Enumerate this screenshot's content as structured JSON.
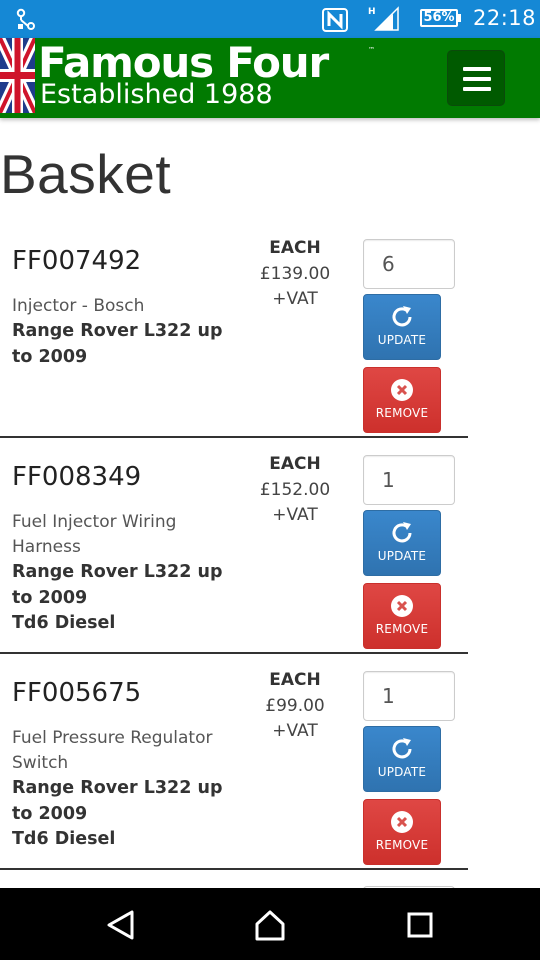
{
  "status_bar": {
    "battery_percent": "56%",
    "time": "22:18",
    "network_indicator": "H",
    "icons": [
      "ongoing-notification-icon",
      "nfc-icon",
      "signal-icon",
      "battery-icon"
    ],
    "background_color": "#1588d5"
  },
  "header": {
    "brand_name": "Famous Four",
    "trademark": "™",
    "tagline": "Established 1988",
    "background_color": "#017a01",
    "icons": [
      "union-jack-flag-icon",
      "hamburger-menu-icon"
    ]
  },
  "page": {
    "title": "Basket"
  },
  "basket": {
    "items": [
      {
        "code": "FF007492",
        "description": "Injector - Bosch",
        "fitment": [
          "Range Rover L322 up to 2009"
        ],
        "price_label": "EACH",
        "price": "£139.00",
        "vat_note": "+VAT",
        "quantity": "6",
        "update_label": "UPDATE",
        "remove_label": "REMOVE"
      },
      {
        "code": "FF008349",
        "description": "Fuel Injector Wiring Harness",
        "fitment": [
          "Range Rover L322 up to 2009",
          "Td6 Diesel"
        ],
        "price_label": "EACH",
        "price": "£152.00",
        "vat_note": "+VAT",
        "quantity": "1",
        "update_label": "UPDATE",
        "remove_label": "REMOVE"
      },
      {
        "code": "FF005675",
        "description": "Fuel Pressure Regulator Switch",
        "fitment": [
          "Range Rover L322 up to 2009",
          "Td6 Diesel"
        ],
        "price_label": "EACH",
        "price": "£99.00",
        "vat_note": "+VAT",
        "quantity": "1",
        "update_label": "UPDATE",
        "remove_label": "REMOVE"
      }
    ],
    "update_color": "#337ab7",
    "remove_color": "#d9534f"
  },
  "nav_bar": {
    "icons": [
      "back-icon",
      "home-icon",
      "recents-icon"
    ]
  }
}
